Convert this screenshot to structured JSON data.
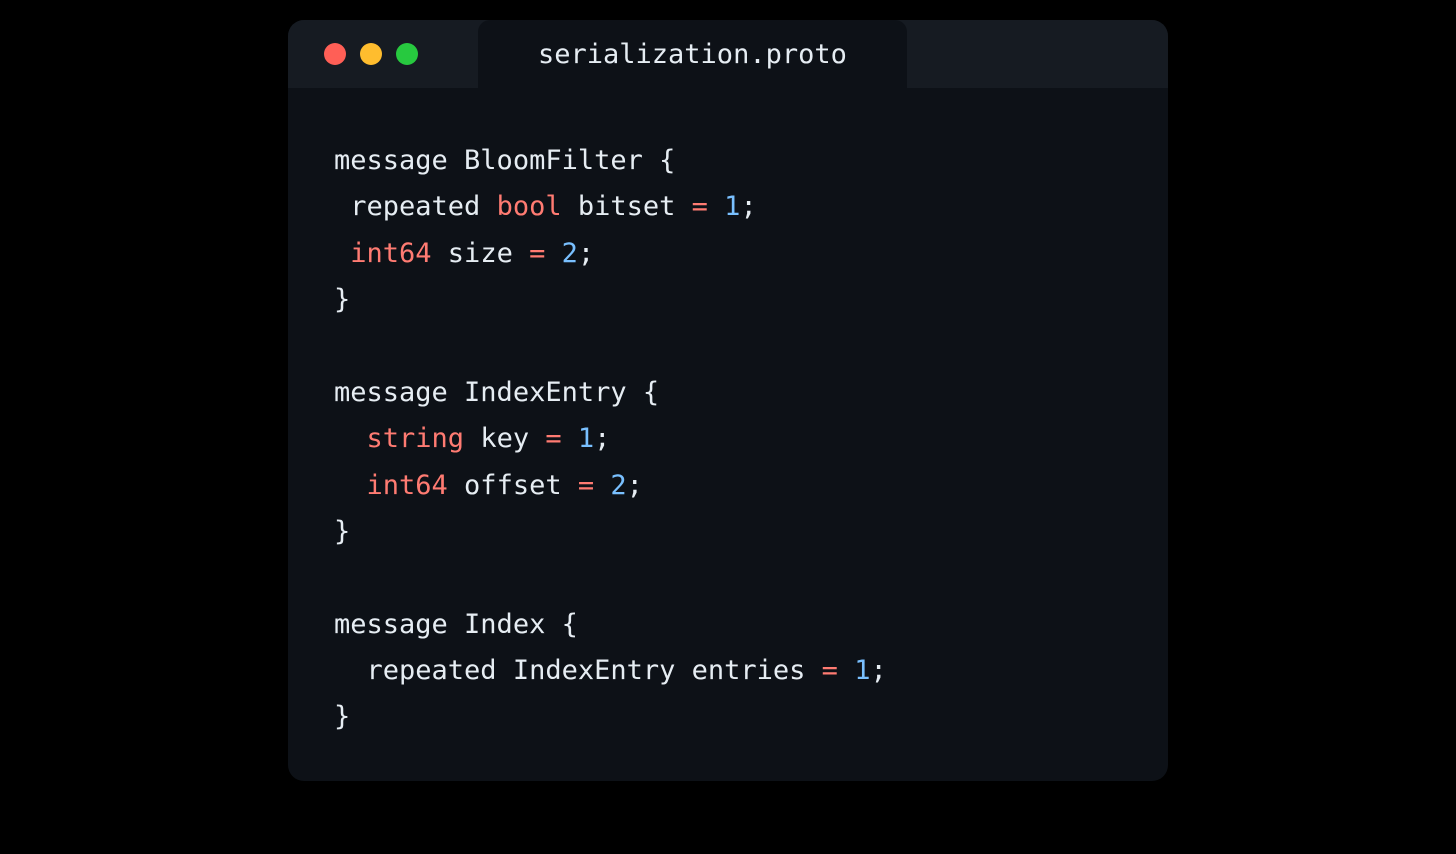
{
  "window": {
    "tab_title": "serialization.proto",
    "traffic_lights": {
      "close": "red",
      "minimize": "yellow",
      "maximize": "green"
    }
  },
  "code": {
    "lines": [
      {
        "tokens": [
          {
            "t": "message ",
            "c": "keyword"
          },
          {
            "t": "BloomFilter {",
            "c": "ident"
          }
        ]
      },
      {
        "tokens": [
          {
            "t": " repeated ",
            "c": "keyword"
          },
          {
            "t": "bool",
            "c": "type"
          },
          {
            "t": " bitset ",
            "c": "ident"
          },
          {
            "t": "=",
            "c": "op"
          },
          {
            "t": " ",
            "c": "ident"
          },
          {
            "t": "1",
            "c": "num"
          },
          {
            "t": ";",
            "c": "punct"
          }
        ]
      },
      {
        "tokens": [
          {
            "t": " ",
            "c": "ident"
          },
          {
            "t": "int64",
            "c": "type"
          },
          {
            "t": " size ",
            "c": "ident"
          },
          {
            "t": "=",
            "c": "op"
          },
          {
            "t": " ",
            "c": "ident"
          },
          {
            "t": "2",
            "c": "num"
          },
          {
            "t": ";",
            "c": "punct"
          }
        ]
      },
      {
        "tokens": [
          {
            "t": "}",
            "c": "punct"
          }
        ]
      },
      {
        "empty": true
      },
      {
        "tokens": [
          {
            "t": "message ",
            "c": "keyword"
          },
          {
            "t": "IndexEntry {",
            "c": "ident"
          }
        ]
      },
      {
        "tokens": [
          {
            "t": "  ",
            "c": "ident"
          },
          {
            "t": "string",
            "c": "type"
          },
          {
            "t": " key ",
            "c": "ident"
          },
          {
            "t": "=",
            "c": "op"
          },
          {
            "t": " ",
            "c": "ident"
          },
          {
            "t": "1",
            "c": "num"
          },
          {
            "t": ";",
            "c": "punct"
          }
        ]
      },
      {
        "tokens": [
          {
            "t": "  ",
            "c": "ident"
          },
          {
            "t": "int64",
            "c": "type"
          },
          {
            "t": " offset ",
            "c": "ident"
          },
          {
            "t": "=",
            "c": "op"
          },
          {
            "t": " ",
            "c": "ident"
          },
          {
            "t": "2",
            "c": "num"
          },
          {
            "t": ";",
            "c": "punct"
          }
        ]
      },
      {
        "tokens": [
          {
            "t": "}",
            "c": "punct"
          }
        ]
      },
      {
        "empty": true
      },
      {
        "tokens": [
          {
            "t": "message ",
            "c": "keyword"
          },
          {
            "t": "Index {",
            "c": "ident"
          }
        ]
      },
      {
        "tokens": [
          {
            "t": "  repeated ",
            "c": "keyword"
          },
          {
            "t": "IndexEntry entries ",
            "c": "ident"
          },
          {
            "t": "=",
            "c": "op"
          },
          {
            "t": " ",
            "c": "ident"
          },
          {
            "t": "1",
            "c": "num"
          },
          {
            "t": ";",
            "c": "punct"
          }
        ]
      },
      {
        "tokens": [
          {
            "t": "}",
            "c": "punct"
          }
        ]
      }
    ]
  }
}
